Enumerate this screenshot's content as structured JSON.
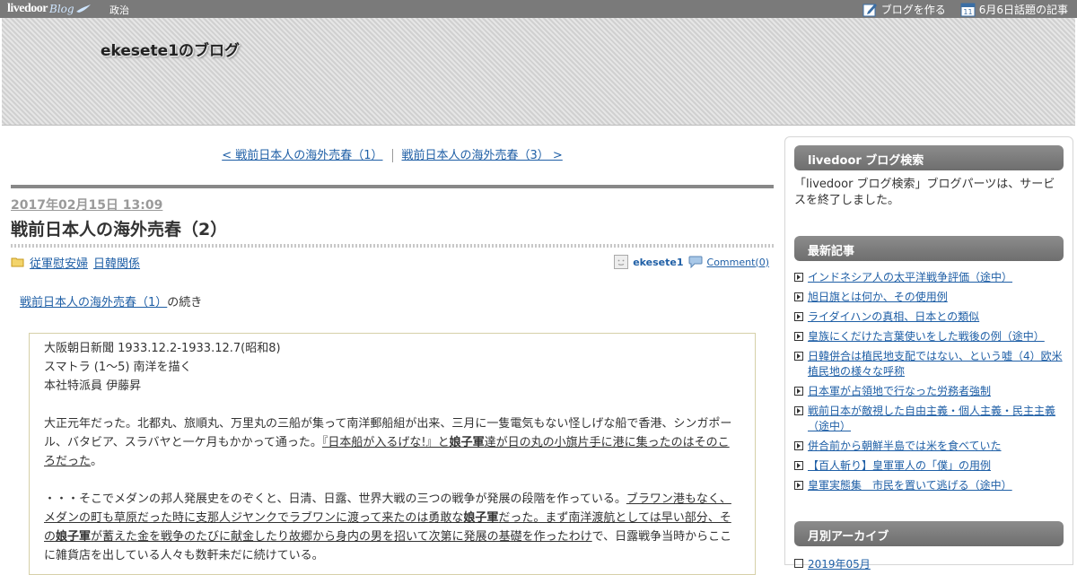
{
  "topbar": {
    "logo_text": "livedoor",
    "logo_sub": "Blog",
    "category": "政治",
    "create_blog": "ブログを作る",
    "topics": "6月6日話題の記事",
    "calendar_day": "11"
  },
  "header": {
    "blog_title": "ekesete1のブログ"
  },
  "pager": {
    "prev": "< 戦前日本人の海外売春（1）",
    "next": "戦前日本人の海外売春（3） >"
  },
  "post": {
    "date": "2017年02月15日 13:09",
    "title": "戦前日本人の海外売春（2）",
    "categories": [
      "従軍慰安婦",
      "日韓関係"
    ],
    "author": "ekesete1",
    "comments": "Comment(0)",
    "continued_link": "戦前日本人の海外売春（1）",
    "continued_suffix": "の続き",
    "quote": {
      "line1": "大阪朝日新聞 1933.12.2-1933.12.7(昭和8)",
      "line2": "スマトラ (1〜5) 南洋を描く",
      "line3": "本社特派員 伊藤昇",
      "p1_a": "大正元年だった。北都丸、旅順丸、万里丸の三船が集って南洋郵船組が出来、三月に一隻電気もない怪しげな船で香港、シンガポール、バタビア、スラバヤと一ケ月もかかって通った。",
      "p1_u1": "『日本船が入るげな!』と",
      "p1_b1": "娘子軍",
      "p1_u2": "達が日の丸の小旗片手に港に集ったのはそのころだった",
      "p1_end": "。",
      "p2_a": "・・・そこでメダンの邦人発展史をのぞくと、日清、日露、世界大戦の三つの戦争が発展の段階を作っている。",
      "p2_u1": "ブラワン港もなく、メダンの町も草原だった時に支那人ジヤンクでラブワンに渡って来たのは勇敢な",
      "p2_b1": "娘子軍",
      "p2_u2": "だった。まず南洋渡航としては早い部分、その",
      "p2_b2": "娘子軍",
      "p2_u3": "が蓄えた金を戦争のたびに献金したり故郷から身内の男を招いて次第に発展の基礎を作ったわけ",
      "p2_end": "で、日露戦争当時からここに雑貨店を出している人々も数軒未だに続けている。"
    }
  },
  "sidebar": {
    "search_title": "livedoor ブログ検索",
    "search_body": "「livedoor ブログ検索」ブログパーツは、サービスを終了しました。",
    "recent_title": "最新記事",
    "recent": [
      "インドネシア人の太平洋戦争評価（途中）",
      "旭日旗とは何か、その使用例",
      "ライダイハンの真相、日本との類似",
      "皇族にくだけた言葉使いをした戦後の例（途中）",
      "日韓併合は植民地支配ではない、という嘘（4）欧米植民地の様々な呼称",
      "日本軍が占領地で行なった労務者強制",
      "戦前日本が敵視した自由主義・個人主義・民主主義（途中）",
      "併合前から朝鮮半島では米を食べていた",
      "【百人斬り】皇軍軍人の「僕」の用例",
      "皇軍実態集　市民を置いて逃げる（途中）"
    ],
    "archive_title": "月別アーカイブ",
    "archive_first": "2019年05月"
  }
}
